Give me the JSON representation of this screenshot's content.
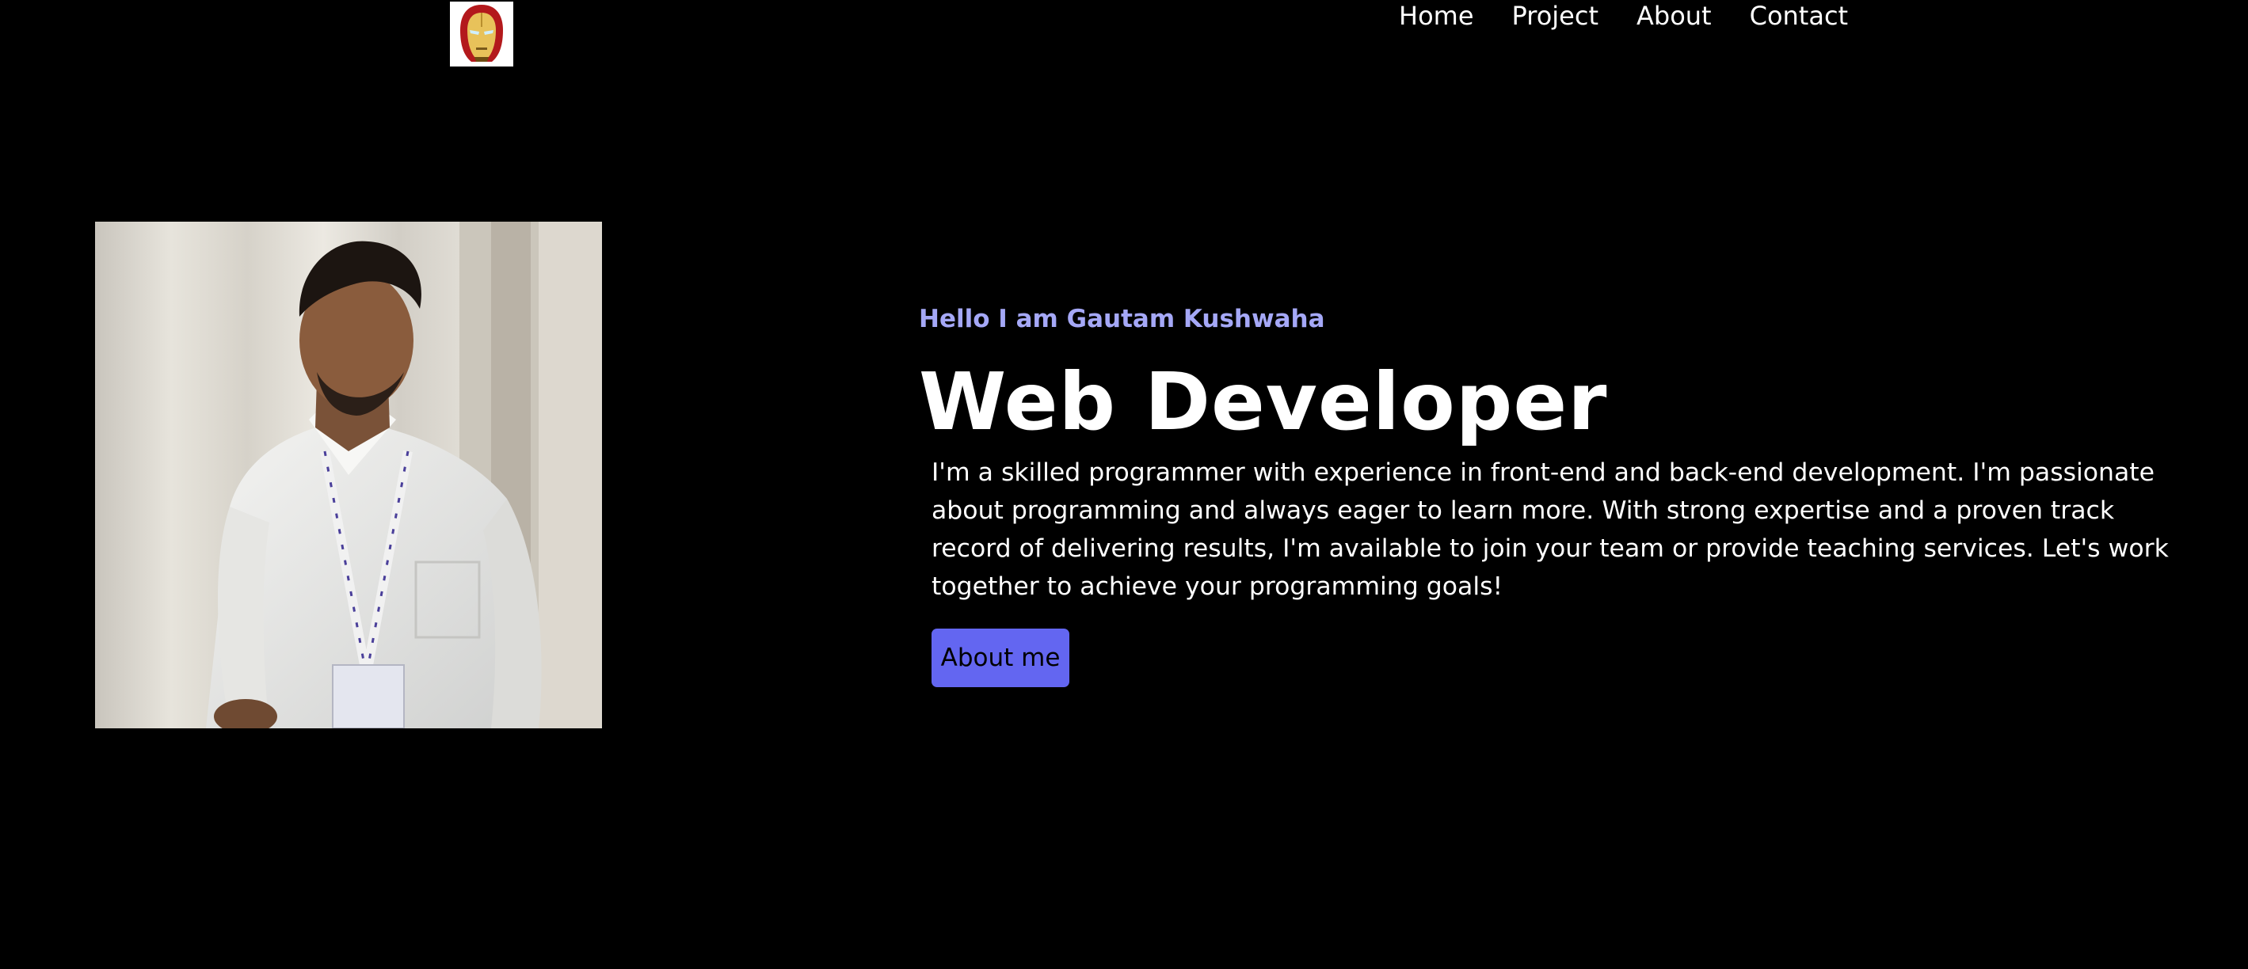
{
  "header": {
    "logo_icon": "iron-man-helmet-icon",
    "nav": [
      {
        "label": "Home"
      },
      {
        "label": "Project"
      },
      {
        "label": "About"
      },
      {
        "label": "Contact"
      }
    ]
  },
  "hero": {
    "greeting": "Hello I am Gautam Kushwaha",
    "title": "Web Developer",
    "description": "I'm a skilled programmer with experience in front-end and back-end development. I'm passionate about programming and always eager to learn more. With strong expertise and a proven track record of delivering results, I'm available to join your team or provide teaching services. Let's work together to achieve your programming goals!",
    "button_label": "About me",
    "photo": "profile-photo"
  },
  "colors": {
    "background": "#000000",
    "accent": "#6366f1",
    "greeting": "#a5a8f7",
    "text": "#ffffff"
  }
}
